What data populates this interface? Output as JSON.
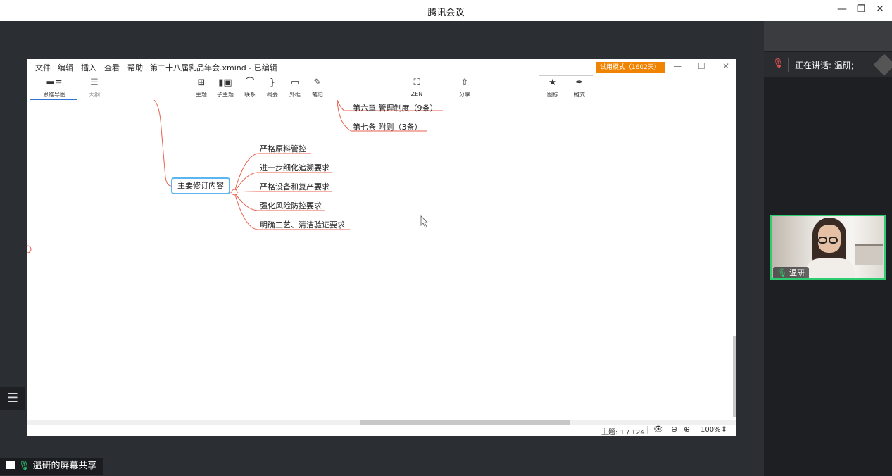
{
  "meeting": {
    "title": "腾讯会议",
    "window_controls": {
      "minimize": "—",
      "restore": "❐",
      "close": "✕"
    },
    "speaking_label": "正在讲话: 温研;",
    "participant_name": "温研",
    "share_label": "温研的屏幕共享"
  },
  "xmind": {
    "menus": [
      "文件",
      "编辑",
      "插入",
      "查看",
      "帮助"
    ],
    "doc_title": "第二十八届乳品年会.xmind - 已编辑",
    "trial_badge": "试用模式（1602天）",
    "window_controls": {
      "minimize": "—",
      "maximize": "☐",
      "close": "✕"
    },
    "tabs": [
      {
        "label": "思维导图",
        "icon": "mindmap-icon",
        "active": true
      },
      {
        "label": "大纲",
        "icon": "outline-icon",
        "active": false
      }
    ],
    "toolbar": {
      "topic": "主题",
      "subtopic": "子主题",
      "relationship": "联系",
      "summary": "概要",
      "boundary": "外框",
      "notes": "笔记",
      "zen": "ZEN",
      "share": "分享",
      "icons": "图标",
      "format": "格式"
    },
    "nodes": {
      "upper": [
        "第六章 管理制度（9条）",
        "第七条 附则（3条）"
      ],
      "central": "主要修订内容",
      "children": [
        "严格原料管控",
        "进一步细化追溯要求",
        "严格设备和复产要求",
        "强化风险防控要求",
        "明确工艺、清洁验证要求"
      ]
    },
    "status": {
      "topics": "主题: 1 / 124",
      "zoom": "100%"
    },
    "colors": {
      "branch": "#e8604c",
      "central_border": "#5bb6f0",
      "trial": "#f08300",
      "active_tab": "#2d74d6"
    }
  }
}
